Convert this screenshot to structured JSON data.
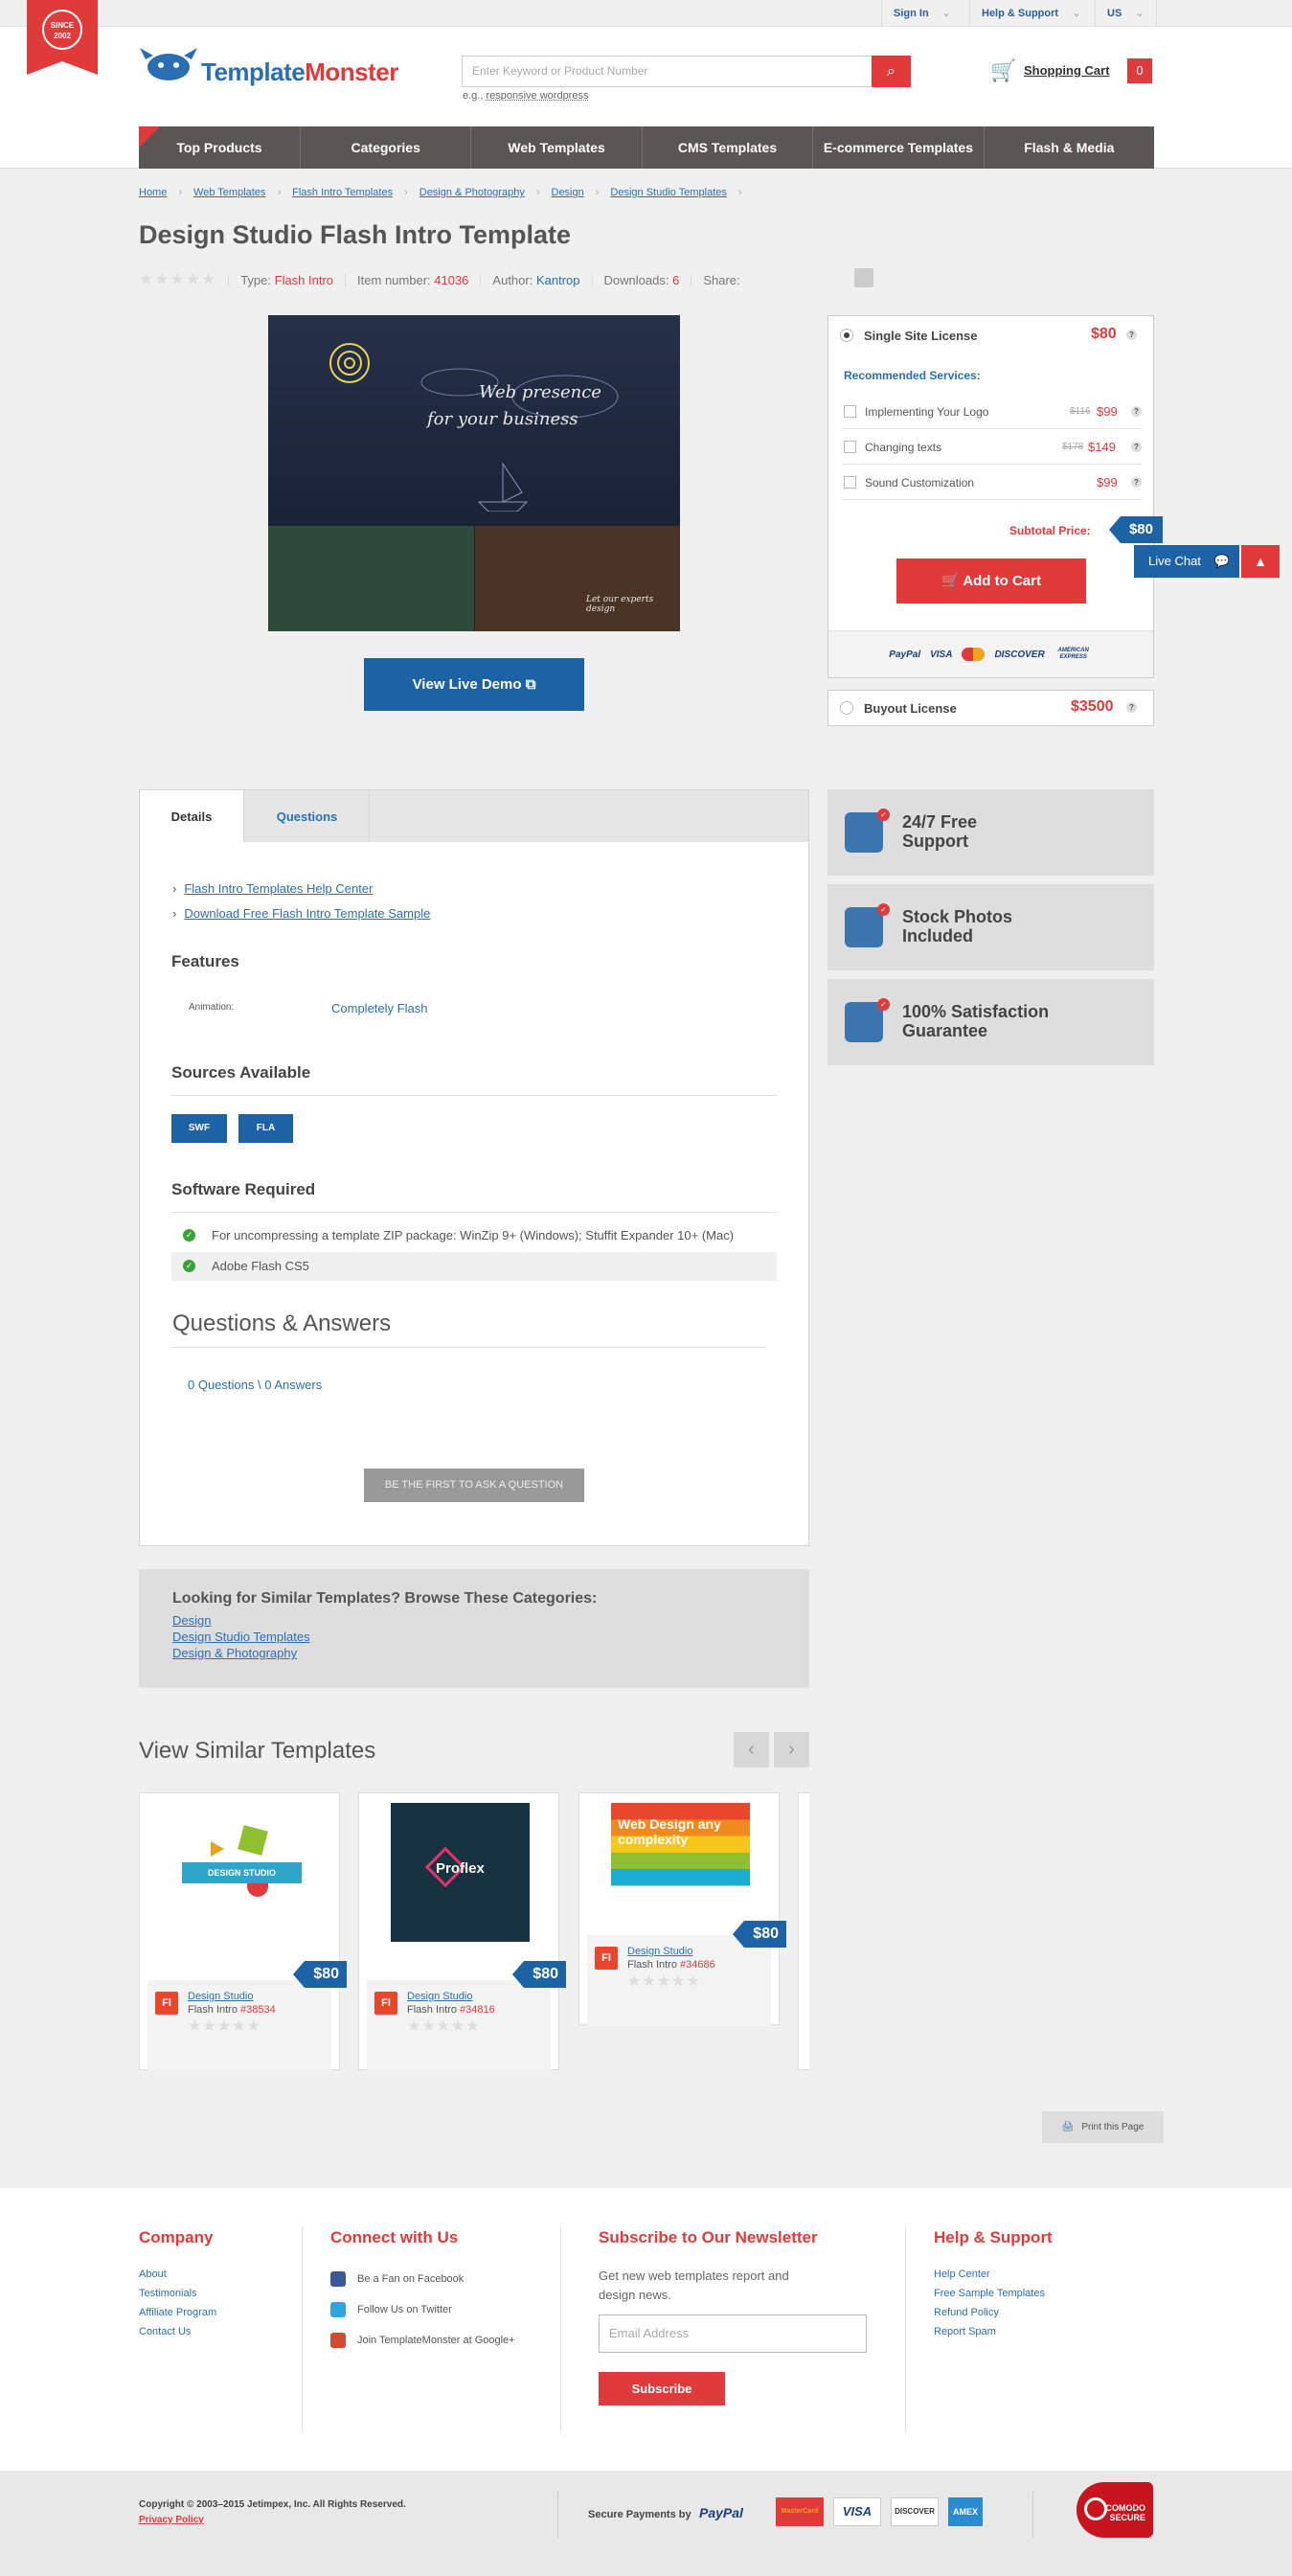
{
  "topbar": {
    "sign_in": "Sign In",
    "help": "Help & Support",
    "locale": "US"
  },
  "badge": {
    "line1": "SINCE",
    "line2": "2002"
  },
  "logo": {
    "part1": "Template",
    "part2": "Monster"
  },
  "search": {
    "placeholder": "Enter Keyword or Product Number",
    "hint_prefix": "e.g.,",
    "hint_link": "responsive wordpress"
  },
  "cart": {
    "label": "Shopping Cart",
    "count": "0"
  },
  "nav": [
    "Top Products",
    "Categories",
    "Web Templates",
    "CMS Templates",
    "E-commerce Templates",
    "Flash & Media"
  ],
  "breadcrumb": [
    "Home",
    "Web Templates",
    "Flash Intro Templates",
    "Design & Photography",
    "Design",
    "Design Studio Templates"
  ],
  "product": {
    "title": "Design Studio Flash Intro Template",
    "stars": "★★★★★",
    "type_label": "Type:",
    "type_value": "Flash Intro",
    "item_label": "Item number:",
    "item_value": "41036",
    "author_label": "Author:",
    "author_value": "Kantrop",
    "downloads_label": "Downloads:",
    "downloads_value": "6",
    "share_label": "Share:",
    "preview_line1": "Web presence",
    "preview_line2": "for your business",
    "preview_small": "Let our experts design",
    "demo_button": "View Live Demo"
  },
  "license": {
    "single_label": "Single Site License",
    "single_price": "$80",
    "recommended_label": "Recommended Services:",
    "services": [
      {
        "label": "Implementing Your Logo",
        "old": "$116",
        "new": "$99"
      },
      {
        "label": "Changing texts",
        "old": "$178",
        "new": "$149"
      },
      {
        "label": "Sound Customization",
        "old": "",
        "new": "$99"
      }
    ],
    "subtotal_label": "Subtotal Price:",
    "subtotal_value": "$80",
    "add_to_cart": "Add to Cart",
    "payments": [
      "PayPal",
      "VISA",
      "MC",
      "DISCOVER",
      "AMERICAN EXPRESS"
    ],
    "buyout_label": "Buyout License",
    "buyout_price": "$3500"
  },
  "livechat": {
    "label": "Live Chat",
    "up": "▲"
  },
  "tabs": {
    "details": "Details",
    "questions": "Questions"
  },
  "details": {
    "links": [
      "Flash Intro Templates Help Center",
      "Download Free Flash Intro Template Sample"
    ],
    "features_h": "Features",
    "animation_label": "Animation:",
    "animation_value": "Completely Flash",
    "sources_h": "Sources Available",
    "sources": [
      "SWF",
      "FLA"
    ],
    "software_h": "Software Required",
    "software": [
      "For uncompressing a template ZIP package: WinZip 9+ (Windows); Stuffit Expander 10+ (Mac)",
      "Adobe Flash CS5"
    ],
    "qa_h": "Questions & Answers",
    "qa_count": "0 Questions \\ 0 Answers",
    "ask_button": "BE THE FIRST TO ASK A QUESTION"
  },
  "similar_categories": {
    "heading": "Looking for Similar Templates? Browse These Categories:",
    "links": [
      "Design",
      "Design Studio Templates",
      "Design & Photography"
    ]
  },
  "features": [
    {
      "line1": "24/7 Free",
      "line2": "Support"
    },
    {
      "line1": "Stock Photos",
      "line2": "Included"
    },
    {
      "line1": "100% Satisfaction",
      "line2": "Guarantee"
    }
  ],
  "similar": {
    "heading": "View Similar Templates",
    "cards": [
      {
        "name": "Design Studio",
        "type": "Flash Intro",
        "number": "#38534",
        "price": "$80",
        "art": "DESIGN STUDIO",
        "icon": "Fl"
      },
      {
        "name": "Design Studio",
        "type": "Flash Intro",
        "number": "#34816",
        "price": "$80",
        "art": "Proflex",
        "icon": "Fl"
      },
      {
        "name": "Design Studio",
        "type": "Flash Intro",
        "number": "#34686",
        "price": "$80",
        "art": "Web Design any complexity",
        "icon": "Fl"
      }
    ]
  },
  "print": "Print this Page",
  "footer": {
    "company_h": "Company",
    "company_links": [
      "About",
      "Testimonials",
      "Affiliate Program",
      "Contact Us"
    ],
    "connect_h": "Connect with Us",
    "connect_links": [
      "Be a Fan on Facebook",
      "Follow Us on Twitter",
      "Join TemplateMonster at Google+"
    ],
    "newsletter_h": "Subscribe to Our Newsletter",
    "newsletter_text": "Get new web templates report and design news.",
    "email_placeholder": "Email Address",
    "subscribe": "Subscribe",
    "help_h": "Help & Support",
    "help_links": [
      "Help Center",
      "Free Sample Templates",
      "Refund Policy",
      "Report Spam"
    ],
    "copyright": "Copyright © 2003–2015 Jetimpex, Inc. All Rights Reserved.",
    "privacy": "Privacy Policy",
    "secure_label": "Secure Payments by",
    "paypal": "PayPal",
    "cards": [
      "MasterCard",
      "VISA",
      "DISCOVER",
      "AMEX"
    ],
    "comodo": "COMODO SECURE"
  },
  "colors": {
    "accent_red": "#e03a3a",
    "brand_blue": "#1e62a6",
    "nav_bg": "#5b5553"
  }
}
